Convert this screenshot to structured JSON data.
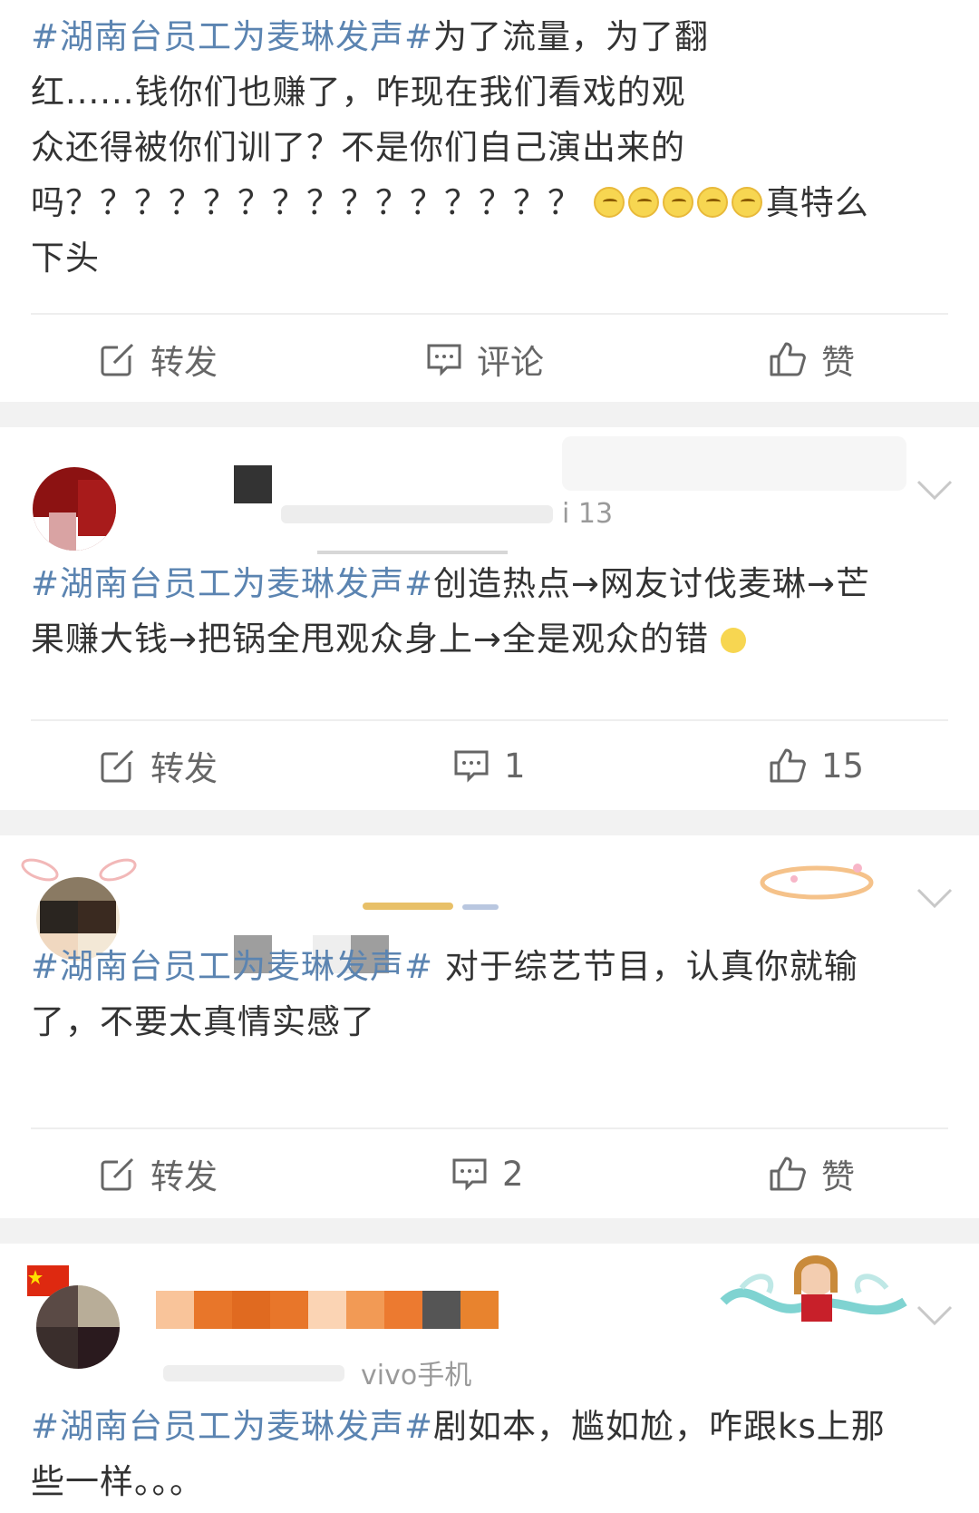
{
  "posts": [
    {
      "hashtag": "#湖南台员工为麦琳发声#",
      "lines": [
        "为了流量，为了翻",
        "红......钱你们也赚了，咋现在我们看戏的观",
        "众还得被你们训了？不是你们自己演出来的",
        "吗？？？？？？？？？？？？？？？",
        "真特么",
        "下头"
      ],
      "repost_label": "转发",
      "comment_label": "评论",
      "like_label": "赞"
    },
    {
      "meta_text": "i 13",
      "hashtag": "#湖南台员工为麦琳发声#",
      "lines": [
        "创造热点→网友讨伐麦琳→芒",
        "果赚大钱→把锅全甩观众身上→全是观众的错"
      ],
      "repost_label": "转发",
      "comment_count": "1",
      "like_count": "15"
    },
    {
      "hashtag": "#湖南台员工为麦琳发声#",
      "lines": [
        " 对于综艺节目，认真你就输",
        "了，不要太真情实感了"
      ],
      "repost_label": "转发",
      "comment_count": "2",
      "like_label": "赞"
    },
    {
      "meta_text": "vivo手机",
      "hashtag": "#湖南台员工为麦琳发声#",
      "lines": [
        "剧如本，尴如尬，咋跟ks上那",
        "些一样。。。"
      ]
    }
  ],
  "colors": {
    "hashtag": "#5b84b1",
    "text": "#333333",
    "action": "#666666",
    "gap": "#f2f2f2"
  }
}
